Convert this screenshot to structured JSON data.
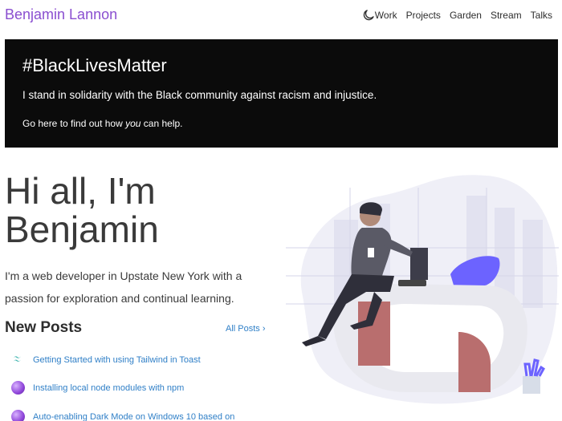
{
  "nav": {
    "brand": "Benjamin Lannon",
    "links": [
      "Work",
      "Projects",
      "Garden",
      "Stream",
      "Talks"
    ]
  },
  "banner": {
    "title": "#BlackLivesMatter",
    "statement": "I stand in solidarity with the Black community against racism and injustice.",
    "help_prefix": "Go here to find out how ",
    "help_emphasis": "you",
    "help_suffix": " can help."
  },
  "hero": {
    "line1": "Hi all, I'm",
    "line2": "Benjamin",
    "intro": "I'm a web developer in Upstate New York with a passion for exploration and continual learning."
  },
  "posts": {
    "heading": "New Posts",
    "all_label": "All Posts",
    "items": [
      {
        "title": "Getting Started with using Tailwind in Toast",
        "icon": "tailwind-icon"
      },
      {
        "title": "Installing local node modules with npm",
        "icon": "npm-ball-icon"
      },
      {
        "title": "Auto-enabling Dark Mode on Windows 10 based on",
        "icon": "windows-ball-icon"
      }
    ]
  },
  "colors": {
    "brand": "#8a4fd0",
    "link": "#2f7fc7",
    "banner_bg": "#0b0b0b",
    "illustration_accent": "#6c63ff",
    "illustration_desk": "#b96e6e"
  }
}
